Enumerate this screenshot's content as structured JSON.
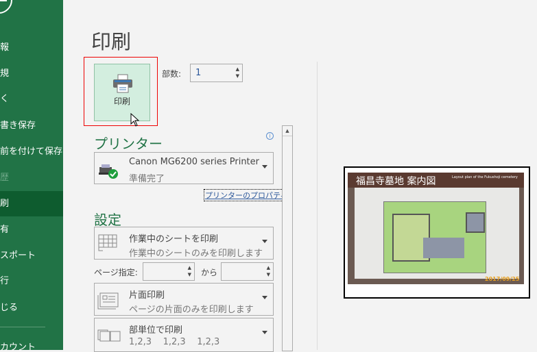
{
  "sidebar": {
    "items": [
      {
        "label": "報"
      },
      {
        "label": "規"
      },
      {
        "label": "く"
      },
      {
        "label": "書き保存"
      },
      {
        "label": "前を付けて保存"
      },
      {
        "label": "歴"
      },
      {
        "label": "刷"
      },
      {
        "label": "有"
      },
      {
        "label": "スポート"
      },
      {
        "label": "行"
      },
      {
        "label": "じる"
      },
      {
        "label": "カウント"
      }
    ],
    "selected": "刷"
  },
  "title": "印刷",
  "print_button": {
    "label": "印刷"
  },
  "copies": {
    "label": "部数:",
    "value": "1"
  },
  "printer": {
    "heading": "プリンター",
    "name": "Canon MG6200 series Printer",
    "status": "準備完了",
    "properties_link": "プリンターのプロパティ"
  },
  "settings": {
    "heading": "設定",
    "what": {
      "title": "作業中のシートを印刷",
      "desc": "作業中のシートのみを印刷します"
    },
    "pages": {
      "label": "ページ指定:",
      "from": "",
      "to_label": "から",
      "to": ""
    },
    "sides": {
      "title": "片面印刷",
      "desc": "ページの片面のみを印刷します"
    },
    "collate": {
      "title": "部単位で印刷",
      "desc": "1,2,3    1,2,3    1,2,3"
    }
  },
  "preview": {
    "sign_title": "福昌寺墓地 案内図",
    "sign_subtitle": "Layout plan of the Fukushoji cemetery",
    "date_stamp": "2017/09/25"
  },
  "colors": {
    "sidebar": "#217346",
    "selected": "#0e5c2f",
    "accent": "#217346",
    "link": "#2b579a"
  }
}
